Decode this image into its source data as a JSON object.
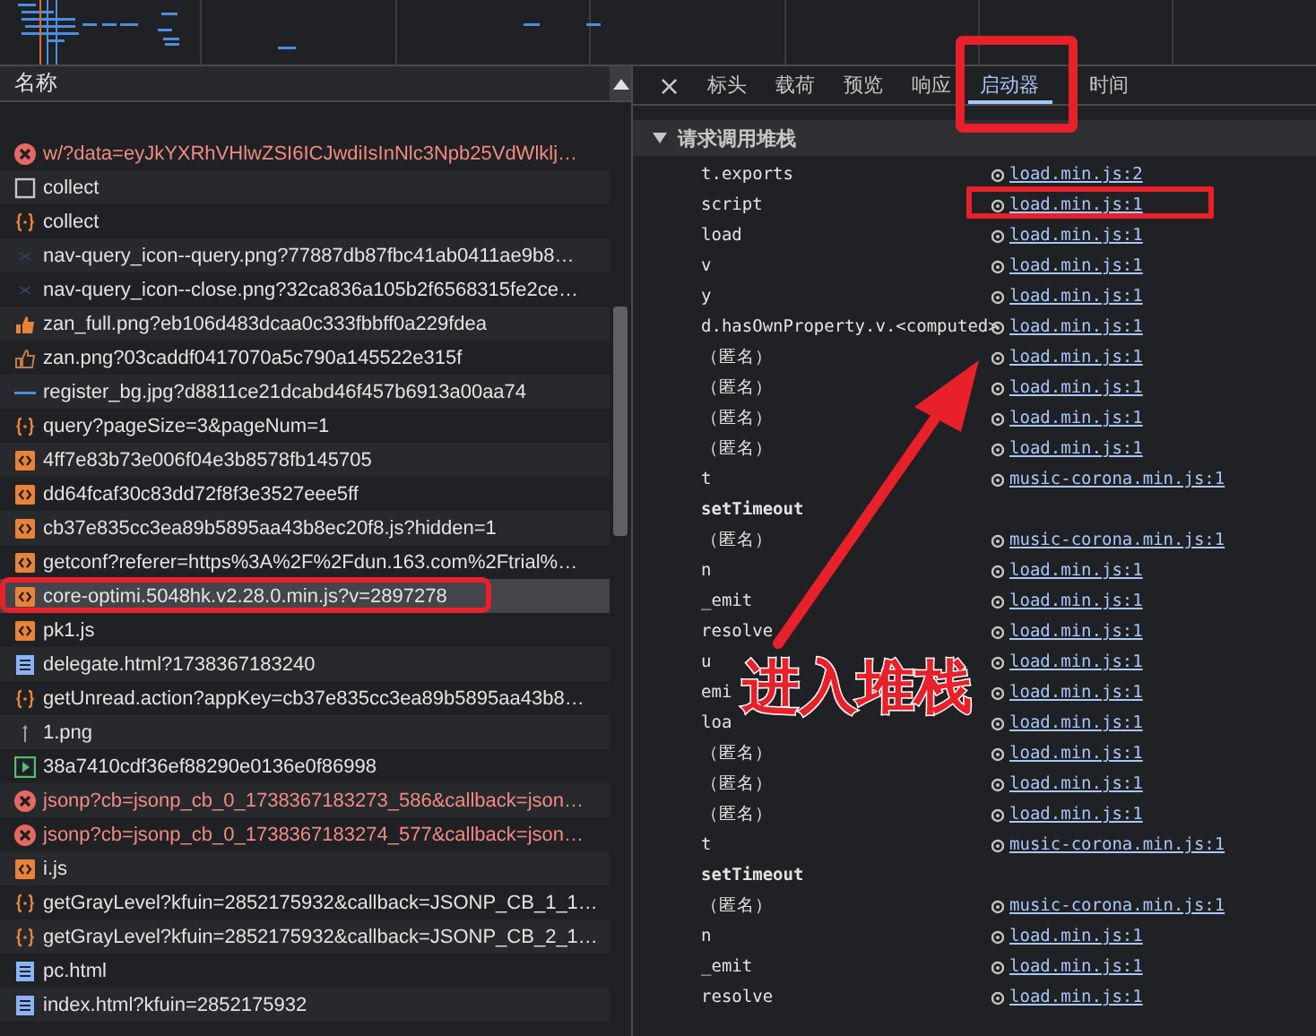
{
  "requests": {
    "header": "名称",
    "rows": [
      {
        "name": "w/?data=eyJkYXRhVHlwZSI6ICJwdiIsInNlc3Npb25VdWlklj…",
        "kind": "error",
        "selected": false
      },
      {
        "name": "collect",
        "kind": "blank",
        "selected": false
      },
      {
        "name": "collect",
        "kind": "xhr",
        "selected": false
      },
      {
        "name": "nav-query_icon--query.png?77887db87fbc41ab0411ae9b8…",
        "kind": "image",
        "selected": false
      },
      {
        "name": "nav-query_icon--close.png?32ca836a105b2f6568315fe2ce…",
        "kind": "image",
        "selected": false
      },
      {
        "name": "zan_full.png?eb106d483dcaa0c333fbbff0a229fdea",
        "kind": "thumb",
        "selected": false
      },
      {
        "name": "zan.png?03caddf0417070a5c790a145522e315f",
        "kind": "thumb-outline",
        "selected": false
      },
      {
        "name": "register_bg.jpg?d8811ce21dcabd46f457b6913a00aa74",
        "kind": "line",
        "selected": false
      },
      {
        "name": "query?pageSize=3&pageNum=1",
        "kind": "xhr",
        "selected": false
      },
      {
        "name": "4ff7e83b73e006f04e3b8578fb145705",
        "kind": "script",
        "selected": false
      },
      {
        "name": "dd64fcaf30c83dd72f8f3e3527eee5ff",
        "kind": "script",
        "selected": false
      },
      {
        "name": "cb37e835cc3ea89b5895aa43b8ec20f8.js?hidden=1",
        "kind": "script",
        "selected": false
      },
      {
        "name": "getconf?referer=https%3A%2F%2Fdun.163.com%2Ftrial%…",
        "kind": "script",
        "selected": false
      },
      {
        "name": "core-optimi.5048hk.v2.28.0.min.js?v=2897278",
        "kind": "script",
        "selected": true
      },
      {
        "name": "pk1.js",
        "kind": "script",
        "selected": false
      },
      {
        "name": "delegate.html?1738367183240",
        "kind": "document",
        "selected": false
      },
      {
        "name": "getUnread.action?appKey=cb37e835cc3ea89b5895aa43b8…",
        "kind": "xhr",
        "selected": false
      },
      {
        "name": "1.png",
        "kind": "other",
        "selected": false
      },
      {
        "name": "38a7410cdf36ef88290e0136e0f86998",
        "kind": "media",
        "selected": false
      },
      {
        "name": "jsonp?cb=jsonp_cb_0_1738367183273_586&callback=json…",
        "kind": "error",
        "selected": false
      },
      {
        "name": "jsonp?cb=jsonp_cb_0_1738367183274_577&callback=json…",
        "kind": "error",
        "selected": false
      },
      {
        "name": "i.js",
        "kind": "script",
        "selected": false
      },
      {
        "name": "getGrayLevel?kfuin=2852175932&callback=JSONP_CB_1_1…",
        "kind": "xhr",
        "selected": false
      },
      {
        "name": "getGrayLevel?kfuin=2852175932&callback=JSONP_CB_2_1…",
        "kind": "xhr",
        "selected": false
      },
      {
        "name": "pc.html",
        "kind": "document",
        "selected": false
      },
      {
        "name": "index.html?kfuin=2852175932",
        "kind": "document",
        "selected": false
      }
    ]
  },
  "details": {
    "close": "×",
    "tabs": [
      {
        "label": "标头",
        "selected": false
      },
      {
        "label": "载荷",
        "selected": false
      },
      {
        "label": "预览",
        "selected": false
      },
      {
        "label": "响应",
        "selected": false
      },
      {
        "label": "启动器",
        "selected": true
      },
      {
        "label": "时间",
        "selected": false
      }
    ],
    "section": {
      "title": "请求调用堆栈",
      "expanded": true,
      "frames": [
        {
          "kind": "frame",
          "fn": "t.exports",
          "link": "load.min.js:2"
        },
        {
          "kind": "frame",
          "fn": "script",
          "link": "load.min.js:1"
        },
        {
          "kind": "frame",
          "fn": "load",
          "link": "load.min.js:1"
        },
        {
          "kind": "frame",
          "fn": "v",
          "link": "load.min.js:1"
        },
        {
          "kind": "frame",
          "fn": "y",
          "link": "load.min.js:1"
        },
        {
          "kind": "frame",
          "fn": "d.hasOwnProperty.v.<computed>",
          "link": "load.min.js:1"
        },
        {
          "kind": "frame",
          "fn": "（匿名）",
          "link": "load.min.js:1"
        },
        {
          "kind": "frame",
          "fn": "（匿名）",
          "link": "load.min.js:1"
        },
        {
          "kind": "frame",
          "fn": "（匿名）",
          "link": "load.min.js:1"
        },
        {
          "kind": "frame",
          "fn": "（匿名）",
          "link": "load.min.js:1"
        },
        {
          "kind": "frame",
          "fn": "t",
          "link": "music-corona.min.js:1"
        },
        {
          "kind": "async",
          "fn": "setTimeout"
        },
        {
          "kind": "frame",
          "fn": "（匿名）",
          "link": "music-corona.min.js:1"
        },
        {
          "kind": "frame",
          "fn": "n",
          "link": "load.min.js:1"
        },
        {
          "kind": "frame",
          "fn": "_emit",
          "link": "load.min.js:1"
        },
        {
          "kind": "frame",
          "fn": "resolve",
          "link": "load.min.js:1"
        },
        {
          "kind": "frame",
          "fn": "u",
          "link": "load.min.js:1"
        },
        {
          "kind": "frame",
          "fn": "emi",
          "link": "load.min.js:1"
        },
        {
          "kind": "frame",
          "fn": "loa",
          "link": "load.min.js:1"
        },
        {
          "kind": "frame",
          "fn": "（匿名）",
          "link": "load.min.js:1"
        },
        {
          "kind": "frame",
          "fn": "（匿名）",
          "link": "load.min.js:1"
        },
        {
          "kind": "frame",
          "fn": "（匿名）",
          "link": "load.min.js:1"
        },
        {
          "kind": "frame",
          "fn": "t",
          "link": "music-corona.min.js:1"
        },
        {
          "kind": "async",
          "fn": "setTimeout"
        },
        {
          "kind": "frame",
          "fn": "（匿名）",
          "link": "music-corona.min.js:1"
        },
        {
          "kind": "frame",
          "fn": "n",
          "link": "load.min.js:1"
        },
        {
          "kind": "frame",
          "fn": "_emit",
          "link": "load.min.js:1"
        },
        {
          "kind": "frame",
          "fn": "resolve",
          "link": "load.min.js:1"
        }
      ]
    }
  },
  "annotation": {
    "callout": "进入堆栈"
  }
}
